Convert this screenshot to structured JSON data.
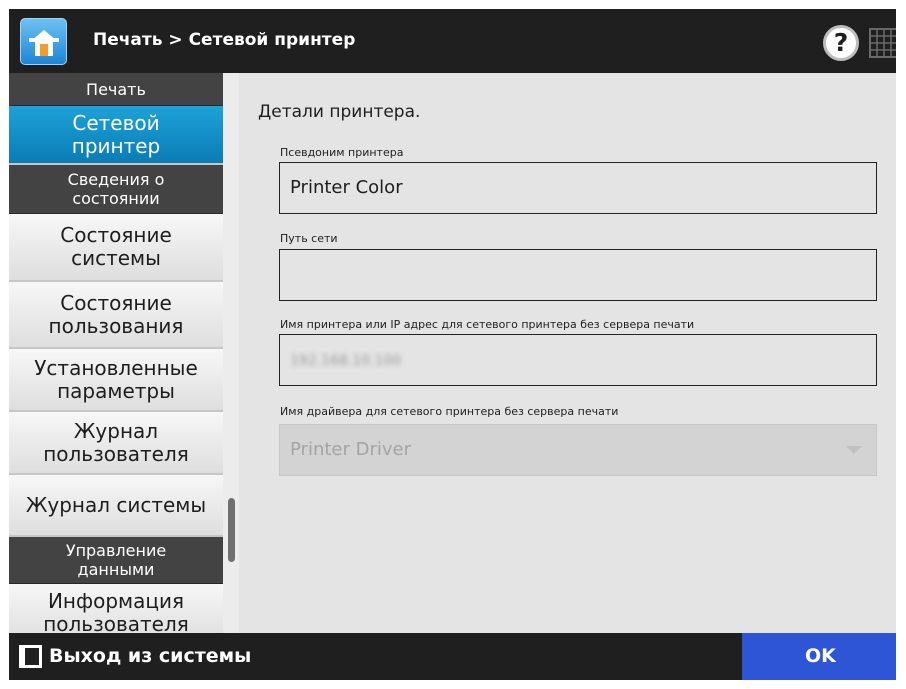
{
  "header": {
    "title": "Печать > Сетевой принтер",
    "help_label": "?",
    "home_icon": "home-icon",
    "keyboard_icon": "keyboard-icon"
  },
  "sidebar": {
    "print_section": "Печать",
    "network_printer": [
      "Сетевой",
      "принтер"
    ],
    "status_section": [
      "Сведения о",
      "состоянии"
    ],
    "system_status": [
      "Состояние",
      "системы"
    ],
    "usage_status": [
      "Состояние",
      "пользования"
    ],
    "installed_params": [
      "Установленные",
      "параметры"
    ],
    "user_log": [
      "Журнал",
      "пользователя"
    ],
    "system_log": "Журнал системы",
    "data_section": [
      "Управление",
      "данными"
    ],
    "user_info": [
      "Информация",
      "пользователя"
    ]
  },
  "main": {
    "title": "Детали принтера.",
    "fields": [
      {
        "label": "Псевдоним принтера",
        "value": "Printer Color"
      },
      {
        "label": "Путь сети",
        "value": ""
      },
      {
        "label": "Имя принтера или IP адрес для сетевого принтера без сервера печати",
        "value": "192.168.10.100"
      }
    ],
    "driver": {
      "label": "Имя драйвера для сетевого принтера без сервера печати",
      "value": "Printer Driver"
    }
  },
  "footer": {
    "logout_label": "Выход из системы",
    "ok_label": "OK"
  },
  "colors": {
    "active_item": "#0a7bb5",
    "ok_button": "#2d55d5",
    "header": "#1f1f1f"
  }
}
